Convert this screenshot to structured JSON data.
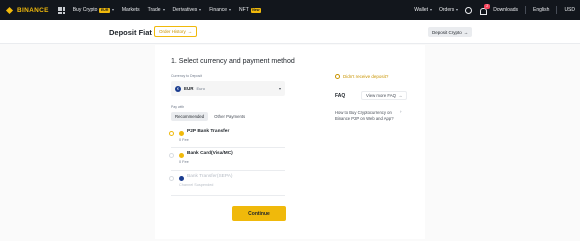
{
  "brand": "BINANCE",
  "nav": {
    "items": [
      {
        "label": "Buy Crypto",
        "badge": "EUR",
        "caret": true
      },
      {
        "label": "Markets",
        "badge": null,
        "caret": false
      },
      {
        "label": "Trade",
        "badge": null,
        "caret": true
      },
      {
        "label": "Derivatives",
        "badge": null,
        "caret": true
      },
      {
        "label": "Finance",
        "badge": null,
        "caret": true
      },
      {
        "label": "NFT",
        "badge": "New",
        "caret": false
      }
    ],
    "right": {
      "wallet": "Wallet",
      "orders": "Orders",
      "notifications_count": "2",
      "downloads": "Downloads",
      "language": "English",
      "currency": "USD"
    }
  },
  "header": {
    "title": "Deposit Fiat",
    "order_history": "Order History",
    "deposit_crypto": "Deposit Crypto"
  },
  "form": {
    "section_title": "1. Select currency and payment method",
    "currency_label": "Currency to Deposit",
    "currency": {
      "symbol": "€",
      "code": "EUR",
      "name": "Euro"
    },
    "pay_with_label": "Pay with",
    "tabs": [
      {
        "label": "Recommended",
        "active": true
      },
      {
        "label": "Other Payments",
        "active": false
      }
    ],
    "methods": [
      {
        "name": "P2P Bank Transfer",
        "sub": "0 Fee",
        "selected": true,
        "disabled": false,
        "icon_color": "#f0b90b"
      },
      {
        "name": "Bank Card(Visa/MC)",
        "sub": "0 Fee",
        "selected": false,
        "disabled": false,
        "icon_color": "#f0b90b"
      },
      {
        "name": "Bank Transfer(SEPA)",
        "sub": "Channel Suspended",
        "selected": false,
        "disabled": true,
        "icon_color": "#1a3c8f"
      }
    ],
    "continue_label": "Continue"
  },
  "side": {
    "not_received": "Didn't receive deposit?",
    "faq_title": "FAQ",
    "view_more": "View more FAQ",
    "faq_item": "How to Buy Cryptocurrency on Binance P2P on Web and App?"
  },
  "colors": {
    "accent": "#f0b90b",
    "nav_bg": "#12161c"
  }
}
